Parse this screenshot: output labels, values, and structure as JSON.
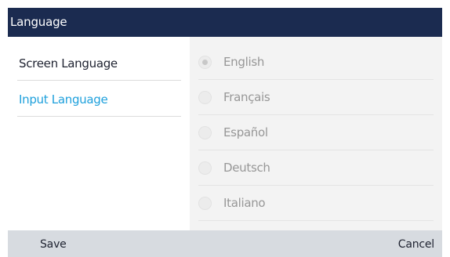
{
  "header": {
    "title": "Language"
  },
  "sidebar": {
    "items": [
      {
        "label": "Screen Language",
        "active": false
      },
      {
        "label": "Input Language",
        "active": true
      }
    ]
  },
  "languages": {
    "selected": "English",
    "options": [
      {
        "label": "English",
        "checked": true
      },
      {
        "label": "Français",
        "checked": false
      },
      {
        "label": "Español",
        "checked": false
      },
      {
        "label": "Deutsch",
        "checked": false
      },
      {
        "label": "Italiano",
        "checked": false
      }
    ]
  },
  "softkeys": {
    "save_label": "Save",
    "cancel_label": "Cancel"
  },
  "colors": {
    "titlebar": "#1b2b50",
    "accent": "#1ea0dc",
    "footer": "#d7dbe0",
    "panel": "#f3f3f3"
  }
}
